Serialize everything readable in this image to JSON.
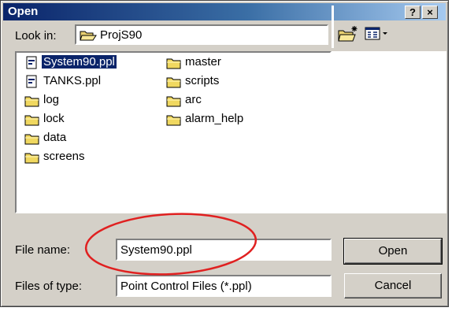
{
  "window": {
    "title": "Open",
    "help_label": "?",
    "close_label": "×"
  },
  "look_in": {
    "label": "Look in:",
    "value": "ProjS90"
  },
  "toolbar": {
    "new_folder_icon": "new-folder-icon",
    "view_menu_icon": "view-menu-icon"
  },
  "files": {
    "items": [
      {
        "name": "System90.ppl",
        "type": "ppl-file",
        "selected": true
      },
      {
        "name": "TANKS.ppl",
        "type": "ppl-file"
      },
      {
        "name": "log",
        "type": "folder"
      },
      {
        "name": "lock",
        "type": "folder"
      },
      {
        "name": "data",
        "type": "folder"
      },
      {
        "name": "screens",
        "type": "folder"
      },
      {
        "name": "master",
        "type": "folder"
      },
      {
        "name": "scripts",
        "type": "folder"
      },
      {
        "name": "arc",
        "type": "folder"
      },
      {
        "name": "alarm_help",
        "type": "folder"
      }
    ]
  },
  "file_name": {
    "label": "File name:",
    "value": "System90.ppl"
  },
  "file_type": {
    "label": "Files of type:",
    "value": "Point Control Files (*.ppl)"
  },
  "buttons": {
    "open": "Open",
    "cancel": "Cancel"
  },
  "colors": {
    "title_bar": "#0a246a",
    "dialog_face": "#d4d0c8",
    "selection": "#0a246a",
    "annotation": "#e02020"
  }
}
